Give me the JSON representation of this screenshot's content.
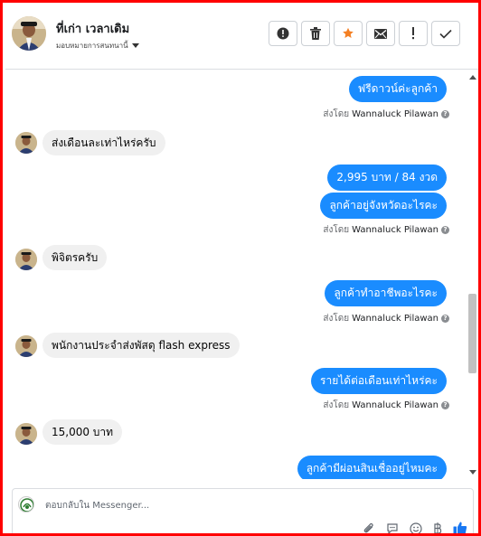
{
  "header": {
    "name": "ที่เก่า เวลาเดิม",
    "assign_label": "มอบหมายการสนทนานี้",
    "toolbar": {
      "icons": [
        "alert-circle-icon",
        "trash-icon",
        "star-icon",
        "envelope-icon",
        "exclamation-icon",
        "check-icon"
      ],
      "star_color": "#f48024"
    }
  },
  "sender_name": "Wannaluck Pilawan",
  "sent_by_prefix": "ส่งโดย",
  "messages": [
    {
      "dir": "out",
      "text": "ฟรีดาวน์ค่ะลูกค้า"
    },
    {
      "dir": "in",
      "text": "ส่งเดือนละเท่าไหร่ครับ"
    },
    {
      "dir": "out",
      "text": "2,995 บาท  / 84 งวด"
    },
    {
      "dir": "out",
      "text": "ลูกค้าอยู่จังหวัดอะไรคะ"
    },
    {
      "dir": "in",
      "text": "พิจิตรครับ"
    },
    {
      "dir": "out",
      "text": "ลูกค้าทำอาชีพอะไรคะ"
    },
    {
      "dir": "in",
      "text": "พนักงานประจำส่งพัสดุ flash express"
    },
    {
      "dir": "out",
      "text": "รายได้ต่อเดือนเท่าไหร่คะ"
    },
    {
      "dir": "in",
      "text": "15,000 บาท"
    },
    {
      "dir": "out",
      "text": "ลูกค้ามีผ่อนสินเชื่ออยู่ไหมคะ"
    }
  ],
  "composer": {
    "placeholder": "ตอบกลับใน Messenger...",
    "tools": [
      "attachment-icon",
      "chat-bubble-icon",
      "emoji-icon",
      "baht-icon",
      "thumbs-up-icon"
    ]
  },
  "colors": {
    "outgoing_bubble": "#1a8cff",
    "incoming_bubble": "#f0f0f0",
    "frame_border": "#ff0000",
    "like_icon": "#1877f2"
  }
}
